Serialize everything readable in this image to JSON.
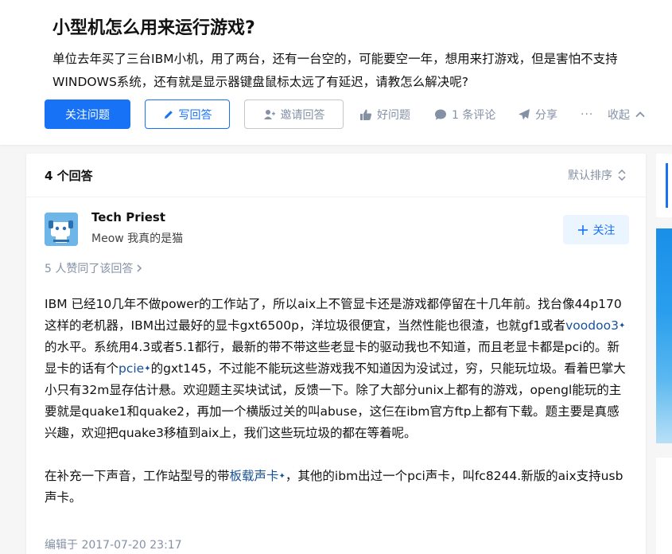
{
  "question": {
    "title": "小型机怎么用来运行游戏?",
    "description": "单位去年买了三台IBM小机，用了两台，还有一台空的，可能要空一年，想用来打游戏，但是害怕不支持WINDOWS系统，还有就是显示器键盘鼠标太远了有延迟，请教怎么解决呢?",
    "actions": {
      "follow": "关注问题",
      "write": "写回答",
      "invite": "邀请回答",
      "good_question": "好问题",
      "comments": "1 条评论",
      "share": "分享",
      "more": "···",
      "collapse": "收起"
    }
  },
  "answers_header": {
    "count": "4 个回答",
    "sort": "默认排序"
  },
  "answer": {
    "author_name": "Tech Priest",
    "author_bio": "Meow 我真的是猫",
    "follow_label": "关注",
    "voters": "5 人赞同了该回答",
    "p1_a": "IBM 已经10几年不做power的工作站了，所以aix上不管显卡还是游戏都停留在十几年前。找台像44p170这样的老机器，IBM出过最好的显卡gxt6500p，洋垃圾很便宜，当然性能也很渣，也就gf1或者",
    "p1_link1": "voodoo3",
    "p1_b": "的水平。系统用4.3或者5.1都行，最新的带不带这些老显卡的驱动我也不知道，而且老显卡都是pci的。新显卡的话有个",
    "p1_link2": "pcie",
    "p1_c": "的gxt145，不过能不能玩这些游戏我不知道因为没试过，穷，只能玩垃圾。看着巴掌大小只有32m显存估计悬。欢迎题主买块试试，反馈一下。除了大部分unix上都有的游戏，opengl能玩的主要就是quake1和quake2，再加一个横版过关的叫abuse，这仨在ibm官方ftp上都有下载。题主要是真感兴趣，欢迎把quake3移植到aix上，我们这些玩垃圾的都在等着呢。",
    "p2_a": "在补充一下声音，工作站型号的带",
    "p2_link": "板载声卡",
    "p2_b": "，其他的ibm出过一个pci声卡，叫fc8244.新版的aix支持usb声卡。",
    "link_mark": "✦",
    "edited": "编辑于 2017-07-20 23:17"
  },
  "colors": {
    "primary": "#1772f6",
    "muted": "#8491a5",
    "link": "#175199"
  }
}
